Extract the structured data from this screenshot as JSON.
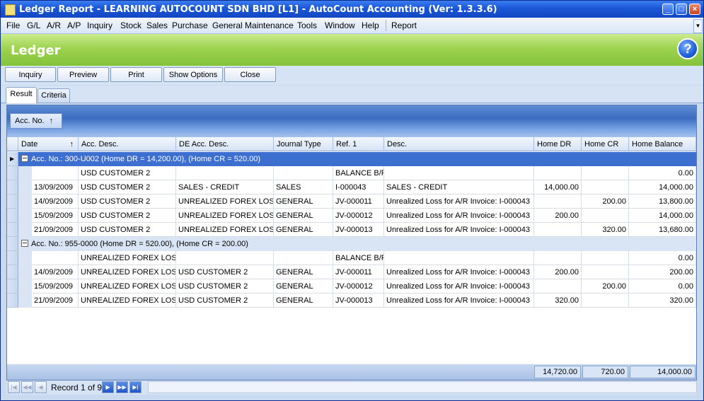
{
  "window": {
    "title": "Ledger Report - LEARNING AUTOCOUNT SDN BHD [L1] - AutoCount Accounting (Ver: 1.3.3.6)",
    "minimize": "_",
    "maximize": "□",
    "close": "×"
  },
  "menu": [
    "File",
    "G/L",
    "A/R",
    "A/P",
    "Inquiry",
    "Stock",
    "Sales",
    "Purchase",
    "General Maintenance",
    "Tools",
    "Window",
    "Help",
    "Report"
  ],
  "header": {
    "title": "Ledger",
    "help": "?"
  },
  "toolbar": {
    "inquiry": "Inquiry",
    "preview": "Preview",
    "print": "Print",
    "show_options": "Show Options",
    "close": "Close"
  },
  "tabs": {
    "result": "Result",
    "criteria": "Criteria"
  },
  "grid": {
    "group_chip": "Acc. No.",
    "columns": [
      "Date",
      "Acc. Desc.",
      "DE Acc. Desc.",
      "Journal Type",
      "Ref. 1",
      "Desc.",
      "Home DR",
      "Home CR",
      "Home Balance"
    ],
    "groups": [
      {
        "label": "Acc. No.: 300-U002 (Home DR = 14,200.00), (Home CR = 520.00)",
        "rows": [
          {
            "date": "",
            "acc_desc": "USD CUSTOMER 2",
            "de_acc_desc": "",
            "journal_type": "",
            "ref1": "BALANCE B/F",
            "desc": "",
            "home_dr": "",
            "home_cr": "",
            "home_balance": "0.00"
          },
          {
            "date": "13/09/2009",
            "acc_desc": "USD CUSTOMER 2",
            "de_acc_desc": "SALES - CREDIT",
            "journal_type": "SALES",
            "ref1": "I-000043",
            "desc": "SALES - CREDIT",
            "home_dr": "14,000.00",
            "home_cr": "",
            "home_balance": "14,000.00"
          },
          {
            "date": "14/09/2009",
            "acc_desc": "USD CUSTOMER 2",
            "de_acc_desc": "UNREALIZED  FOREX LOSS",
            "journal_type": "GENERAL",
            "ref1": "JV-000011",
            "desc": "Unrealized Loss for A/R Invoice: I-000043",
            "home_dr": "",
            "home_cr": "200.00",
            "home_balance": "13,800.00"
          },
          {
            "date": "15/09/2009",
            "acc_desc": "USD CUSTOMER 2",
            "de_acc_desc": "UNREALIZED  FOREX LOSS",
            "journal_type": "GENERAL",
            "ref1": "JV-000012",
            "desc": "Unrealized Loss for A/R Invoice: I-000043",
            "home_dr": "200.00",
            "home_cr": "",
            "home_balance": "14,000.00"
          },
          {
            "date": "21/09/2009",
            "acc_desc": "USD CUSTOMER 2",
            "de_acc_desc": "UNREALIZED  FOREX LOSS",
            "journal_type": "GENERAL",
            "ref1": "JV-000013",
            "desc": "Unrealized Loss for A/R Invoice: I-000043",
            "home_dr": "",
            "home_cr": "320.00",
            "home_balance": "13,680.00"
          }
        ]
      },
      {
        "label": "Acc. No.: 955-0000 (Home DR = 520.00), (Home CR = 200.00)",
        "rows": [
          {
            "date": "",
            "acc_desc": "UNREALIZED  FOREX LOSS",
            "de_acc_desc": "",
            "journal_type": "",
            "ref1": "BALANCE B/F",
            "desc": "",
            "home_dr": "",
            "home_cr": "",
            "home_balance": "0.00"
          },
          {
            "date": "14/09/2009",
            "acc_desc": "UNREALIZED  FOREX LOSS",
            "de_acc_desc": "USD CUSTOMER 2",
            "journal_type": "GENERAL",
            "ref1": "JV-000011",
            "desc": "Unrealized Loss for A/R Invoice: I-000043",
            "home_dr": "200.00",
            "home_cr": "",
            "home_balance": "200.00"
          },
          {
            "date": "15/09/2009",
            "acc_desc": "UNREALIZED  FOREX LOSS",
            "de_acc_desc": "USD CUSTOMER 2",
            "journal_type": "GENERAL",
            "ref1": "JV-000012",
            "desc": "Unrealized Loss for A/R Invoice: I-000043",
            "home_dr": "",
            "home_cr": "200.00",
            "home_balance": "0.00"
          },
          {
            "date": "21/09/2009",
            "acc_desc": "UNREALIZED  FOREX LOSS",
            "de_acc_desc": "USD CUSTOMER 2",
            "journal_type": "GENERAL",
            "ref1": "JV-000013",
            "desc": "Unrealized Loss for A/R Invoice: I-000043",
            "home_dr": "320.00",
            "home_cr": "",
            "home_balance": "320.00"
          }
        ]
      }
    ],
    "totals": {
      "home_dr": "14,720.00",
      "home_cr": "720.00",
      "home_balance": "14,000.00"
    }
  },
  "navigator": {
    "record_text": "Record 1 of 9"
  }
}
